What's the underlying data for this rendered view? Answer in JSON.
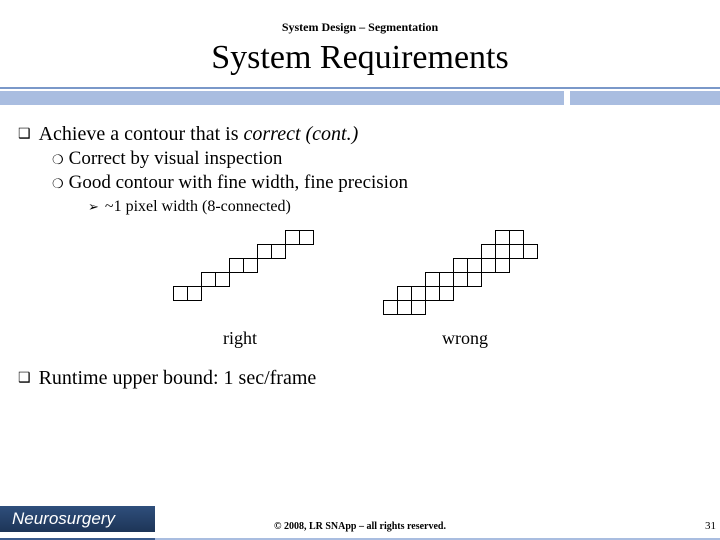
{
  "header": {
    "breadcrumb": "System Design – Segmentation",
    "title": "System Requirements"
  },
  "points": {
    "p1": {
      "prefix": "Achieve a contour that is ",
      "emph": "correct (cont.)"
    },
    "p1a": "Correct by visual inspection",
    "p1b": "Good contour with fine width, fine precision",
    "p1b1": "~1 pixel width (8-connected)",
    "p2": "Runtime upper bound: 1 sec/frame"
  },
  "captions": {
    "right": "right",
    "wrong": "wrong"
  },
  "footer": {
    "logo": "Neurosurgery",
    "copyright": "© 2008, LR SNApp – all rights reserved.",
    "page": "31"
  },
  "chart_data": {
    "type": "table",
    "title": "8-connected contour width illustration",
    "figures": [
      {
        "label": "right",
        "description": "staircase contour 1 pixel wide (8-connected)",
        "cells": [
          [
            8,
            0
          ],
          [
            9,
            0
          ],
          [
            6,
            1
          ],
          [
            7,
            1
          ],
          [
            4,
            2
          ],
          [
            5,
            2
          ],
          [
            2,
            3
          ],
          [
            3,
            3
          ],
          [
            0,
            4
          ],
          [
            1,
            4
          ]
        ]
      },
      {
        "label": "wrong",
        "description": "staircase contour 2 pixels thick",
        "cells": [
          [
            8,
            0
          ],
          [
            9,
            0
          ],
          [
            7,
            1
          ],
          [
            8,
            1
          ],
          [
            9,
            1
          ],
          [
            10,
            1
          ],
          [
            5,
            2
          ],
          [
            6,
            2
          ],
          [
            7,
            2
          ],
          [
            8,
            2
          ],
          [
            3,
            3
          ],
          [
            4,
            3
          ],
          [
            5,
            3
          ],
          [
            6,
            3
          ],
          [
            1,
            4
          ],
          [
            2,
            4
          ],
          [
            3,
            4
          ],
          [
            4,
            4
          ],
          [
            0,
            5
          ],
          [
            1,
            5
          ],
          [
            2,
            5
          ]
        ]
      }
    ],
    "cell_size_px": 14
  }
}
